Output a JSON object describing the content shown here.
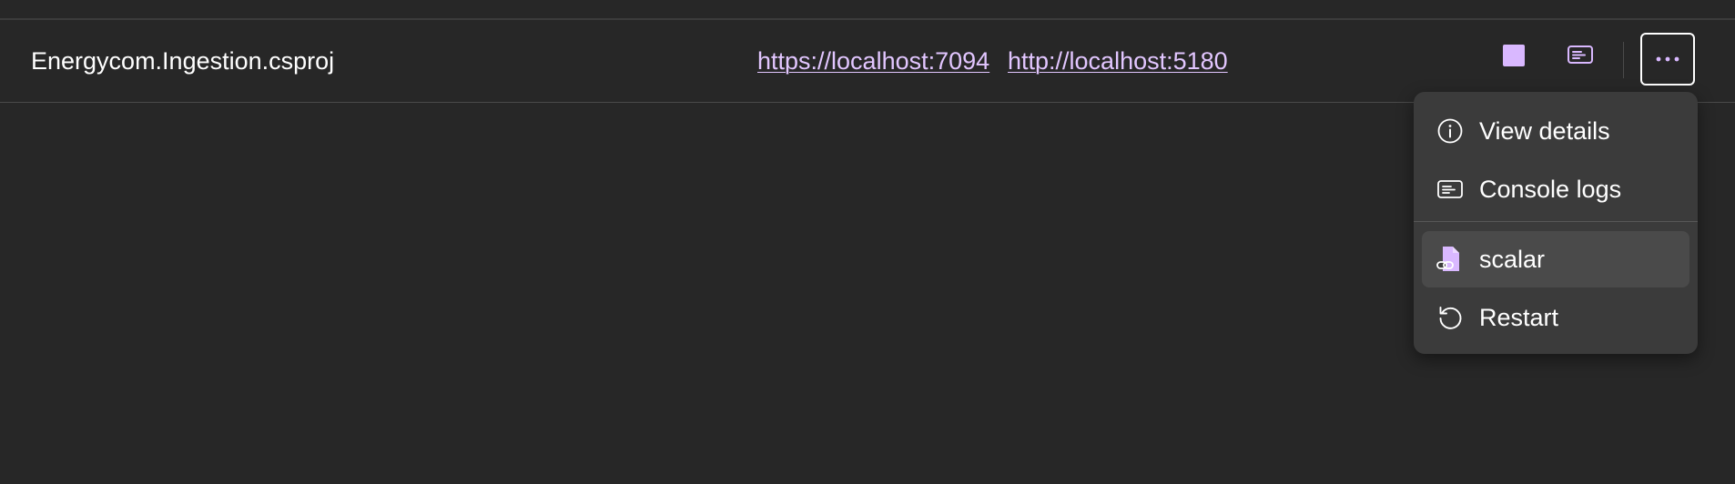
{
  "resource": {
    "name": "Energycom.Ingestion.csproj",
    "endpoints": [
      "https://localhost:7094",
      "http://localhost:5180"
    ]
  },
  "actions": {
    "stop_icon": "stop-square-icon",
    "console_icon": "console-log-icon",
    "more_icon": "ellipsis-icon"
  },
  "context_menu": {
    "items": [
      {
        "label": "View details",
        "icon": "info-circle-icon"
      },
      {
        "label": "Console logs",
        "icon": "console-log-icon"
      },
      {
        "label": "scalar",
        "icon": "document-link-icon",
        "highlighted": true
      },
      {
        "label": "Restart",
        "icon": "restart-arrow-icon"
      }
    ]
  },
  "colors": {
    "background": "#272727",
    "menu_background": "#3b3b3b",
    "menu_highlight": "#4a4a4a",
    "accent": "#d9b8ff",
    "link": "#e2c6ff"
  }
}
